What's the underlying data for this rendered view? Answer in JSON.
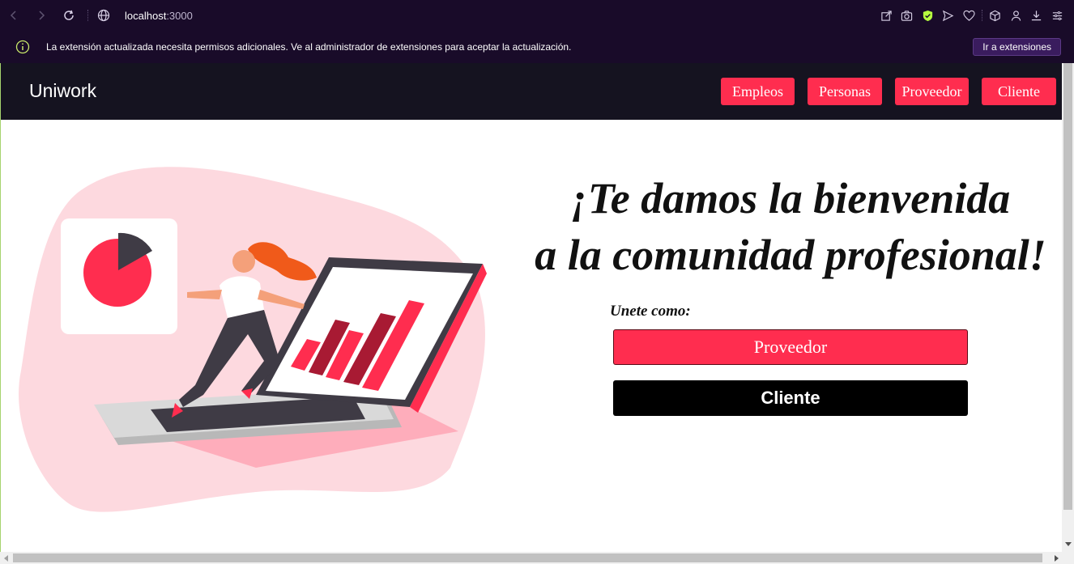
{
  "browser": {
    "url_host": "localhost",
    "url_port": ":3000"
  },
  "info_bar": {
    "message": "La extensión actualizada necesita permisos adicionales. Ve al administrador de extensiones para aceptar la actualización.",
    "button_label": "Ir a extensiones"
  },
  "navbar": {
    "brand": "Uniwork",
    "links": [
      "Empleos",
      "Personas",
      "Proveedor",
      "Cliente"
    ]
  },
  "hero": {
    "headline_line1": "¡Te damos la bienvenida",
    "headline_line2": "a la comunidad profesional!",
    "join_label": "Unete como:",
    "provider_button": "Proveedor",
    "client_button": "Cliente"
  },
  "colors": {
    "accent": "#ff2d4f",
    "navbar": "#151320",
    "browser_chrome": "#190b29"
  }
}
